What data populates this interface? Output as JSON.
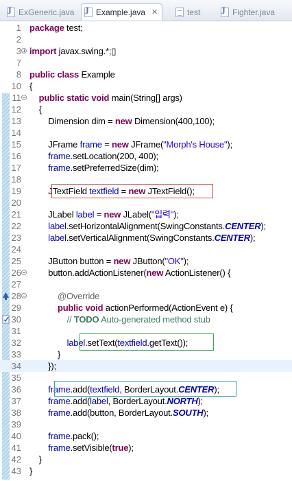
{
  "tabs": [
    {
      "label": "ExGeneric.java",
      "icon": "java-file-icon",
      "active": false
    },
    {
      "label": "Example.java",
      "icon": "java-file-icon",
      "active": true,
      "close": "✕"
    },
    {
      "label": "test",
      "icon": "text-file-icon",
      "active": false
    },
    {
      "label": "Fighter.java",
      "icon": "java-file-icon",
      "active": false
    }
  ],
  "colors": {
    "keyword": "#7f0055",
    "field": "#0000c0",
    "string": "#2a00ff",
    "comment": "#3f7f5f",
    "annotation": "#646464",
    "box_red": "#d0474a",
    "box_green": "#3aa655",
    "box_teal": "#2aa0b0"
  },
  "lines": [
    {
      "n": "1",
      "html": "<span class='k'>package</span> test;"
    },
    {
      "n": "2",
      "html": ""
    },
    {
      "n": "3",
      "fold": "plus",
      "html": "<span class='k'>import</span> javax.swing.*;&#9647;"
    },
    {
      "n": "7",
      "html": ""
    },
    {
      "n": "8",
      "html": "<span class='k'>public</span> <span class='k'>class</span> Example"
    },
    {
      "n": "10",
      "html": "{"
    },
    {
      "n": "11",
      "fold": "minus",
      "html": "    <span class='k'>public</span> <span class='k'>static</span> <span class='k'>void</span> main(String[] args)"
    },
    {
      "n": "12",
      "html": "    {"
    },
    {
      "n": "13",
      "html": "        Dimension dim = <span class='k'>new</span> Dimension(400,100);"
    },
    {
      "n": "14",
      "html": ""
    },
    {
      "n": "15",
      "html": "        JFrame <span class='f'>frame</span> = <span class='k'>new</span> JFrame(<span class='s'>\"Morph's House\"</span>);"
    },
    {
      "n": "16",
      "html": "        <span class='f'>frame</span>.setLocation(200, 400);"
    },
    {
      "n": "17",
      "html": "        <span class='f'>frame</span>.setPreferredSize(dim);"
    },
    {
      "n": "18",
      "html": ""
    },
    {
      "n": "19",
      "html": "        JTextField <span class='f'>textfield</span> = <span class='k'>new</span> JTextField();"
    },
    {
      "n": "20",
      "html": ""
    },
    {
      "n": "21",
      "html": "        JLabel <span class='f'>label</span> = <span class='k'>new</span> JLabel(<span class='s'>\"입력\"</span>);"
    },
    {
      "n": "22",
      "html": "        <span class='f'>label</span>.setHorizontalAlignment(SwingConstants.<span class='sf'>CENTER</span>);"
    },
    {
      "n": "23",
      "html": "        <span class='f'>label</span>.setVerticalAlignment(SwingConstants.<span class='sf'>CENTER</span>);"
    },
    {
      "n": "24",
      "html": ""
    },
    {
      "n": "25",
      "html": "        JButton button = <span class='k'>new</span> JButton(<span class='s'>\"OK\"</span>);"
    },
    {
      "n": "26",
      "fold": "minus",
      "html": "        button.addActionListener(<span class='k'>new</span> ActionListener() {"
    },
    {
      "n": "27",
      "html": ""
    },
    {
      "n": "28",
      "fold": "minus",
      "marker": "override",
      "html": "            <span class='a'>@Override</span>"
    },
    {
      "n": "29",
      "html": "            <span class='k'>public</span> <span class='k'>void</span> actionPerformed(ActionEvent e) {"
    },
    {
      "n": "30",
      "marker": "task",
      "html": "                <span class='c'>// <b>TODO</b> Auto-generated method stub</span>"
    },
    {
      "n": "31",
      "html": ""
    },
    {
      "n": "32",
      "html": "                <span class='f'>label</span>.setText(<span class='f'>textfield</span>.getText());"
    },
    {
      "n": "33",
      "html": "            }"
    },
    {
      "n": "34",
      "hl": true,
      "html": "        });"
    },
    {
      "n": "35",
      "html": ""
    },
    {
      "n": "36",
      "html": "        <span class='f'>frame</span>.add(<span class='f'>textfield</span>, BorderLayout.<span class='sf'>CENTER</span>);"
    },
    {
      "n": "37",
      "html": "        <span class='f'>frame</span>.add(<span class='f'>label</span>, BorderLayout.<span class='sf'>NORTH</span>);"
    },
    {
      "n": "38",
      "html": "        <span class='f'>frame</span>.add(button, BorderLayout.<span class='sf'>SOUTH</span>);"
    },
    {
      "n": "39",
      "html": ""
    },
    {
      "n": "40",
      "html": "        <span class='f'>frame</span>.pack();"
    },
    {
      "n": "41",
      "html": "        <span class='f'>frame</span>.setVisible(<span class='k'>true</span>);"
    },
    {
      "n": "42",
      "html": "    }"
    },
    {
      "n": "43",
      "html": "}"
    }
  ]
}
